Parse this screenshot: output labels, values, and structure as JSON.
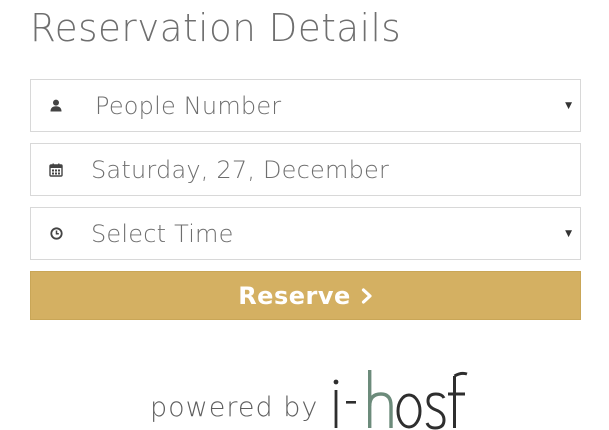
{
  "heading": "Reservation Details",
  "people_select": {
    "value": "People Number",
    "icon": "user-icon"
  },
  "date_field": {
    "value": "Saturday, 27, December",
    "icon": "calendar-icon"
  },
  "time_select": {
    "value": "Select Time",
    "icon": "clock-icon"
  },
  "reserve_button": {
    "label": "Reserve",
    "icon": "chevron-right-icon"
  },
  "footer": {
    "powered_by": "powered by",
    "brand": "i-host"
  },
  "colors": {
    "accent": "#d4b062",
    "text": "#6e6e6e",
    "border": "#d8d8d8",
    "brand_h": "#6c8b7b"
  }
}
